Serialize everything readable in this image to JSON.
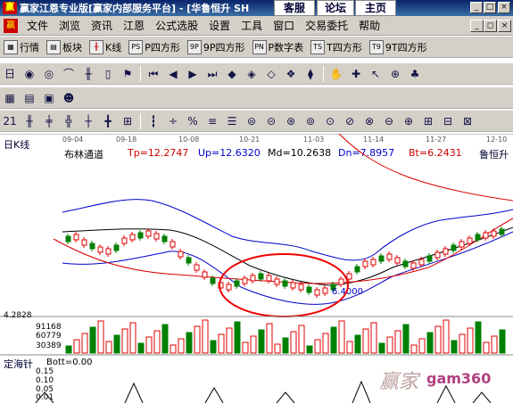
{
  "titlebar": {
    "title": "赢家江恩专业版[赢家内部服务平台] - [华鲁恒升  SH",
    "tabs": [
      "客服",
      "论坛",
      "主页"
    ]
  },
  "menu": {
    "items": [
      "文件",
      "浏览",
      "资讯",
      "江恩",
      "公式选股",
      "设置",
      "工具",
      "窗口",
      "交易委托",
      "帮助"
    ]
  },
  "toolbar1": {
    "items": [
      {
        "label": "行情",
        "icon": "grid-icon"
      },
      {
        "label": "板块",
        "icon": "blocks-icon"
      },
      {
        "label": "K线",
        "icon": "kline-icon"
      },
      {
        "label": "P四方形",
        "icon": "p-square-icon"
      },
      {
        "label": "9P四方形",
        "icon": "9p-square-icon"
      },
      {
        "label": "P数字表",
        "icon": "p-table-icon"
      },
      {
        "label": "T四方形",
        "icon": "t-square-icon"
      },
      {
        "label": "9T四方形",
        "icon": "9t-square-icon"
      }
    ]
  },
  "chart": {
    "period_label": "日K线",
    "stock_name": "鲁恒升",
    "indicator_name": "布林通道",
    "tp": "Tp=12.2747",
    "up": "Up=12.6320",
    "md": "Md=10.2638",
    "dn": "Dn=7.8957",
    "bt": "Bt=6.2431",
    "annotation": "6.4000",
    "dates": [
      "09-04",
      "09-18",
      "10-08",
      "10-21",
      "11-03",
      "11-14",
      "11-27",
      "12-10"
    ],
    "volume_max": "4.2828",
    "volume_ticks": [
      "91168",
      "60779",
      "30389"
    ],
    "sub_label": "定海针",
    "sub_value": "Bott=0.00",
    "sub_ticks": [
      "0.15",
      "0.10",
      "0.05",
      "0.01"
    ],
    "watermark": "gam360",
    "watermark_hanzi": "赢家"
  },
  "colors": {
    "title_bg": "#0a246a",
    "menu_bg": "#d4d0c8",
    "up_candle": "#e00000",
    "down_candle": "#008000",
    "boll_band": "#0000cc",
    "boll_mid": "#000000",
    "ma_red": "#d00000",
    "highlight_circle": "#e00000"
  }
}
